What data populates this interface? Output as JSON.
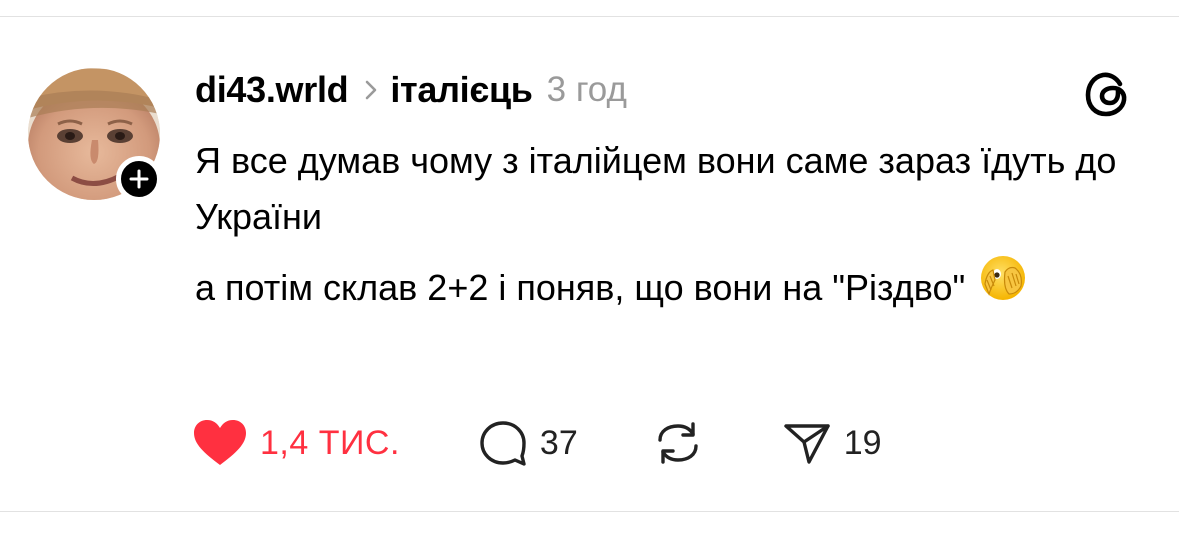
{
  "post": {
    "username": "di43.wrld",
    "topic": "італієць",
    "time": "3 год",
    "text_lines": [
      "Я все думав чому з італійцем вони саме зараз їдуть до України",
      "а потім склав 2+2 і поняв, що вони на \"Різдво\""
    ],
    "emoji": "🫣"
  },
  "actions": {
    "likes": "1,4 ТИС.",
    "comments": "37",
    "shares": "19"
  },
  "icons": {
    "like": "heart-filled-icon",
    "comment": "comment-bubble-icon",
    "repost": "repost-icon",
    "share": "paper-plane-icon",
    "chevron": "chevron-right-icon",
    "logo": "threads-logo-icon",
    "follow": "plus-icon"
  },
  "colors": {
    "like": "#ff3040",
    "muted": "#9a9a9a",
    "text": "#000000"
  }
}
